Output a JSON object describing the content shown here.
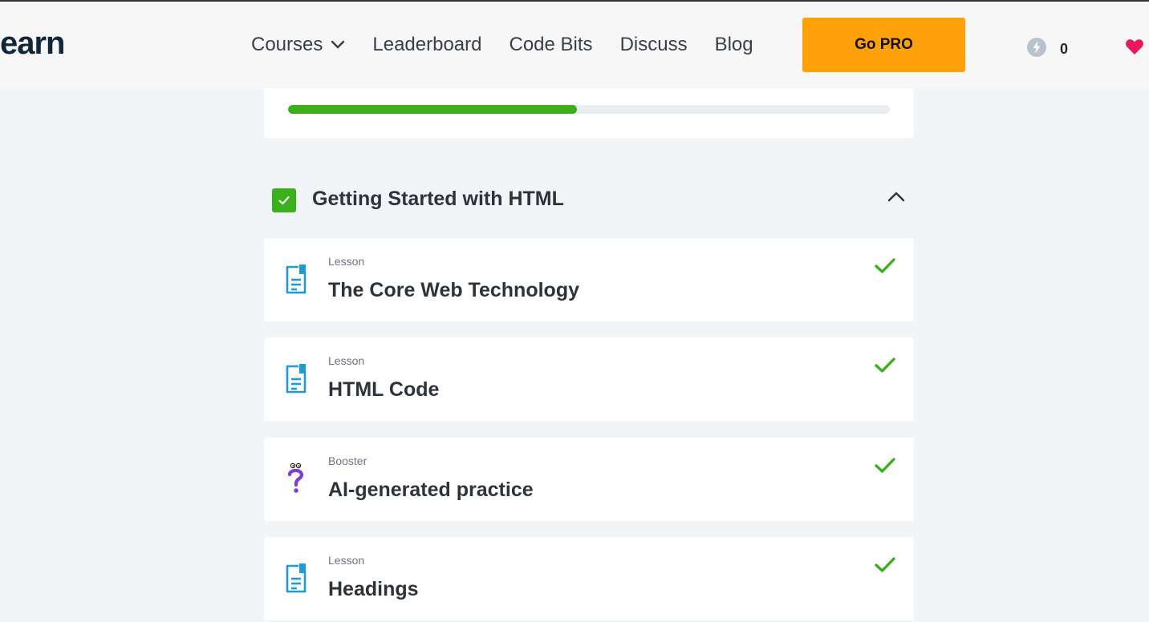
{
  "brand": {
    "logo_text": "earn"
  },
  "nav": {
    "courses": "Courses",
    "leaderboard": "Leaderboard",
    "code_bits": "Code Bits",
    "discuss": "Discuss",
    "blog": "Blog"
  },
  "go_pro_label": "Go PRO",
  "bits": {
    "count": "0"
  },
  "progress": {
    "fraction": 0.48
  },
  "module": {
    "title": "Getting Started with HTML",
    "completed": true
  },
  "lessons": [
    {
      "type": "Lesson",
      "title": "The Core Web Technology",
      "icon": "lesson-doc-icon",
      "completed": true
    },
    {
      "type": "Lesson",
      "title": "HTML Code",
      "icon": "lesson-doc-icon",
      "completed": true
    },
    {
      "type": "Booster",
      "title": "AI-generated practice",
      "icon": "question-mark-icon",
      "completed": true
    },
    {
      "type": "Lesson",
      "title": "Headings",
      "icon": "lesson-doc-icon",
      "completed": true
    }
  ],
  "colors": {
    "accent_green": "#3ab01a",
    "pro_orange": "#ffa10a",
    "lesson_icon_blue": "#1d9bd7",
    "booster_purple": "#7b3fd6",
    "heart_pink": "#e8185a"
  }
}
